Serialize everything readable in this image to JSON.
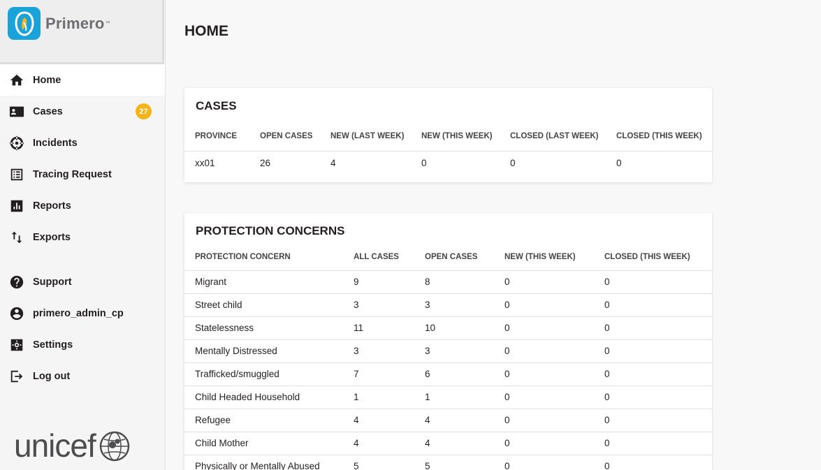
{
  "app": {
    "name": "Primero",
    "trademark": "™"
  },
  "sidebar": {
    "items": [
      {
        "label": "Home",
        "icon": "home-icon",
        "active": true
      },
      {
        "label": "Cases",
        "icon": "cases-card-icon",
        "badge": "27"
      },
      {
        "label": "Incidents",
        "icon": "incidents-icon"
      },
      {
        "label": "Tracing Request",
        "icon": "tracing-request-icon"
      },
      {
        "label": "Reports",
        "icon": "reports-icon"
      },
      {
        "label": "Exports",
        "icon": "exports-icon"
      }
    ],
    "bottom_items": [
      {
        "label": "Support",
        "icon": "help-icon"
      },
      {
        "label": "primero_admin_cp",
        "icon": "user-icon"
      },
      {
        "label": "Settings",
        "icon": "gear-icon"
      },
      {
        "label": "Log out",
        "icon": "logout-icon"
      }
    ],
    "partner_logo": "unicef"
  },
  "page": {
    "title": "HOME"
  },
  "cases": {
    "title": "CASES",
    "columns": [
      "PROVINCE",
      "OPEN CASES",
      "NEW (LAST WEEK)",
      "NEW (THIS WEEK)",
      "CLOSED (LAST WEEK)",
      "CLOSED (THIS WEEK)"
    ],
    "rows": [
      [
        "xx01",
        "26",
        "4",
        "0",
        "0",
        "0"
      ]
    ]
  },
  "protection": {
    "title": "PROTECTION CONCERNS",
    "columns": [
      "PROTECTION CONCERN",
      "ALL CASES",
      "OPEN CASES",
      "NEW (THIS WEEK)",
      "CLOSED (THIS WEEK)"
    ],
    "rows": [
      [
        "Migrant",
        "9",
        "8",
        "0",
        "0"
      ],
      [
        "Street child",
        "3",
        "3",
        "0",
        "0"
      ],
      [
        "Statelessness",
        "11",
        "10",
        "0",
        "0"
      ],
      [
        "Mentally Distressed",
        "3",
        "3",
        "0",
        "0"
      ],
      [
        "Trafficked/smuggled",
        "7",
        "6",
        "0",
        "0"
      ],
      [
        "Child Headed Household",
        "1",
        "1",
        "0",
        "0"
      ],
      [
        "Refugee",
        "4",
        "4",
        "0",
        "0"
      ],
      [
        "Child Mother",
        "4",
        "4",
        "0",
        "0"
      ],
      [
        "Physically or Mentally Abused",
        "5",
        "5",
        "0",
        "0"
      ]
    ]
  },
  "colors": {
    "brand": "#1aa3d8",
    "badge": "#f2b31b",
    "text": "#231f20"
  }
}
